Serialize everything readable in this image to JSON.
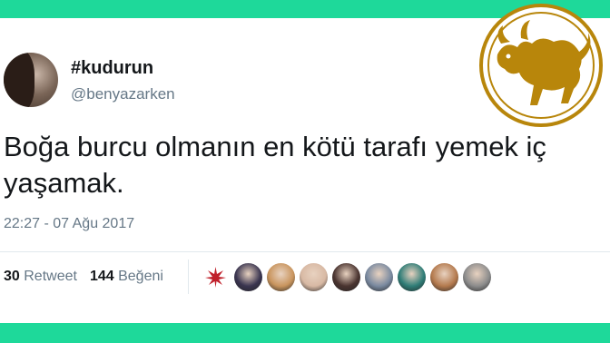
{
  "tweet": {
    "display_name": "#kudurun",
    "handle": "@benyazarken",
    "text_line1": "Boğa burcu olmanın en kötü tarafı yemek iç",
    "text_line2": "yaşamak.",
    "timestamp": "22:27 - 07 Ağu 2017",
    "retweet_count": "30",
    "retweet_label": "Retweet",
    "like_count": "144",
    "like_label": "Beğeni"
  },
  "likers": [
    {
      "name": "liker-avatar-leaf",
      "color": "#c0202b"
    },
    {
      "name": "liker-avatar-2",
      "color": "#3a3550"
    },
    {
      "name": "liker-avatar-3",
      "color": "#c9955e"
    },
    {
      "name": "liker-avatar-4",
      "color": "#d8b9a4"
    },
    {
      "name": "liker-avatar-5",
      "color": "#4a3430"
    },
    {
      "name": "liker-avatar-6",
      "color": "#7a8aa0"
    },
    {
      "name": "liker-avatar-7",
      "color": "#2f7d77"
    },
    {
      "name": "liker-avatar-8",
      "color": "#b47a4e"
    },
    {
      "name": "liker-avatar-9",
      "color": "#8c8c8c"
    }
  ],
  "colors": {
    "accent_band": "#1ed99a",
    "logo_gold": "#b8860b"
  },
  "logo": {
    "icon": "taurus-bull-icon"
  }
}
